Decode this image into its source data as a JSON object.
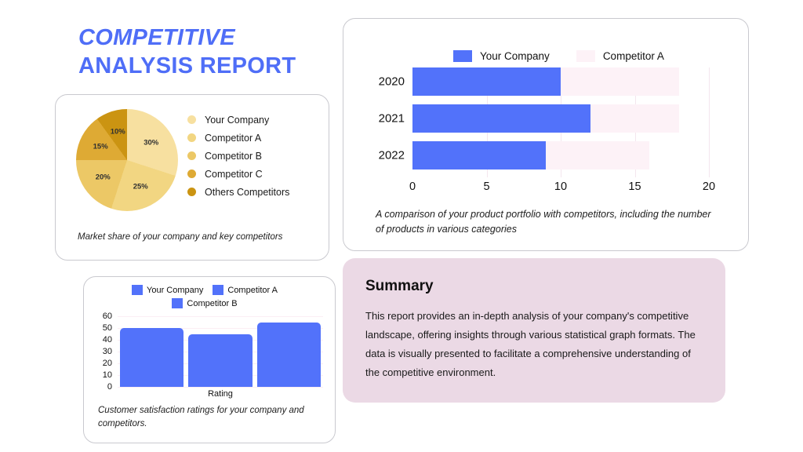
{
  "title": {
    "line1": "COMPETITIVE",
    "line2": "ANALYSIS REPORT",
    "color": "#4f6ef7"
  },
  "colors": {
    "brand_blue": "#5272fa",
    "competitor_pink": "#fdf2f7",
    "summary_bg": "#ebd9e5",
    "gold_1": "#f7e0a0",
    "gold_2": "#f2d682",
    "gold_3": "#ecc866",
    "gold_4": "#deaa34",
    "gold_5": "#cb9412"
  },
  "pie_card": {
    "caption": "Market share of your company and key competitors",
    "legend": [
      {
        "label": "Your Company",
        "color": "#f7e0a0"
      },
      {
        "label": "Competitor A",
        "color": "#f2d682"
      },
      {
        "label": "Competitor B",
        "color": "#ecc866"
      },
      {
        "label": "Competitor C",
        "color": "#deaa34"
      },
      {
        "label": "Others Competitors",
        "color": "#cb9412"
      }
    ],
    "chart_data": {
      "type": "pie",
      "title": "",
      "labels": [
        "Your Company",
        "Competitor A",
        "Competitor B",
        "Competitor C",
        "Others Competitors"
      ],
      "values": [
        30,
        25,
        20,
        15,
        10
      ],
      "value_labels": [
        "30%",
        "25%",
        "20%",
        "15%",
        "10%"
      ],
      "colors": [
        "#f7e0a0",
        "#f2d682",
        "#ecc866",
        "#deaa34",
        "#cb9412"
      ],
      "legend_position": "right"
    }
  },
  "hbar_card": {
    "caption": "A comparison of your product portfolio with competitors, including the number of products in various categories",
    "legend": [
      {
        "label": "Your Company",
        "color": "#5272fa"
      },
      {
        "label": "Competitor A",
        "color": "#fdf2f7"
      }
    ],
    "chart_data": {
      "type": "bar",
      "orientation": "horizontal",
      "title": "",
      "xlabel": "",
      "ylabel": "",
      "categories": [
        "2020",
        "2021",
        "2022"
      ],
      "series": [
        {
          "name": "Your Company",
          "color": "#5272fa",
          "values": [
            10,
            12,
            9
          ]
        },
        {
          "name": "Competitor A",
          "color": "#fdf2f7",
          "values": [
            18,
            18,
            16
          ]
        }
      ],
      "xlim": [
        0,
        20
      ],
      "xticks": [
        0,
        5,
        10,
        15,
        20
      ],
      "xtick_labels": [
        "0",
        "5",
        "10",
        "15",
        "20"
      ],
      "grid": true,
      "legend_position": "top"
    }
  },
  "vbar_card": {
    "caption": "Customer satisfaction ratings for your company and competitors.",
    "legend": [
      {
        "label": "Your Company",
        "color": "#5272fa"
      },
      {
        "label": "Competitor A",
        "color": "#5272fa"
      },
      {
        "label": "Competitor B",
        "color": "#5272fa"
      }
    ],
    "chart_data": {
      "type": "bar",
      "orientation": "vertical",
      "title": "",
      "xlabel": "Rating",
      "ylabel": "",
      "categories": [
        "Your Company",
        "Competitor A",
        "Competitor B"
      ],
      "values": [
        50,
        45,
        55
      ],
      "colors": [
        "#5272fa",
        "#5272fa",
        "#5272fa"
      ],
      "ylim": [
        0,
        60
      ],
      "yticks": [
        0,
        10,
        20,
        30,
        40,
        50,
        60
      ],
      "ytick_labels": [
        "0",
        "10",
        "20",
        "30",
        "40",
        "50",
        "60"
      ],
      "grid": true,
      "legend_position": "top"
    }
  },
  "summary_card": {
    "title": "Summary",
    "body": "This report provides an in-depth analysis of your company's competitive landscape, offering insights through various statistical graph formats. The data is visually presented to facilitate a comprehensive understanding of the competitive environment."
  }
}
